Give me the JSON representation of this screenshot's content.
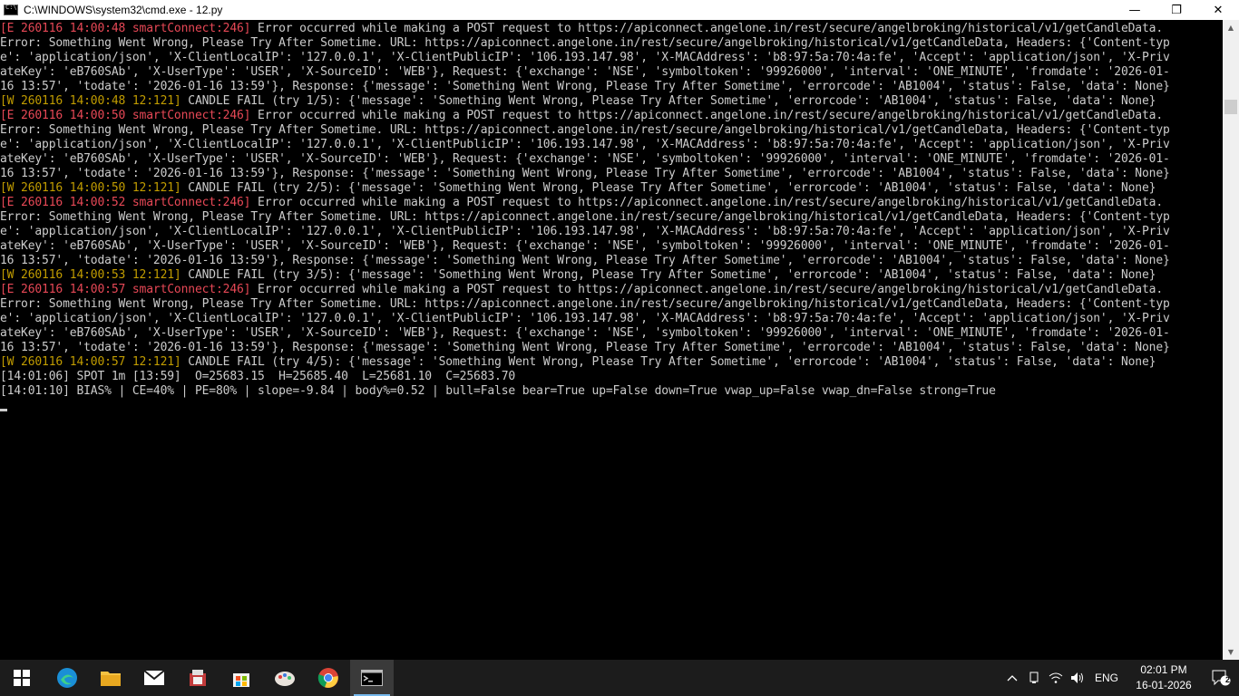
{
  "window": {
    "title": "C:\\WINDOWS\\system32\\cmd.exe - 12.py",
    "minimize_glyph": "—",
    "maximize_glyph": "❐",
    "close_glyph": "✕"
  },
  "console": {
    "lines": [
      {
        "type": "err",
        "prefix": "[E 260116 14:00:48 smartConnect:246]",
        "text": " Error occurred while making a POST request to https://apiconnect.angelone.in/rest/secure/angelbroking/historical/v1/getCandleData."
      },
      {
        "type": "normal",
        "prefix": "",
        "text": "Error: Something Went Wrong, Please Try After Sometime. URL: https://apiconnect.angelone.in/rest/secure/angelbroking/historical/v1/getCandleData, Headers: {'Content-typ"
      },
      {
        "type": "normal",
        "prefix": "",
        "text": "e': 'application/json', 'X-ClientLocalIP': '127.0.0.1', 'X-ClientPublicIP': '106.193.147.98', 'X-MACAddress': 'b8:97:5a:70:4a:fe', 'Accept': 'application/json', 'X-Priv"
      },
      {
        "type": "normal",
        "prefix": "",
        "text": "ateKey': 'eB760SAb', 'X-UserType': 'USER', 'X-SourceID': 'WEB'}, Request: {'exchange': 'NSE', 'symboltoken': '99926000', 'interval': 'ONE_MINUTE', 'fromdate': '2026-01-"
      },
      {
        "type": "normal",
        "prefix": "",
        "text": "16 13:57', 'todate': '2026-01-16 13:59'}, Response: {'message': 'Something Went Wrong, Please Try After Sometime', 'errorcode': 'AB1004', 'status': False, 'data': None}"
      },
      {
        "type": "warn",
        "prefix": "[W 260116 14:00:48 12:121]",
        "text": " CANDLE FAIL (try 1/5): {'message': 'Something Went Wrong, Please Try After Sometime', 'errorcode': 'AB1004', 'status': False, 'data': None}"
      },
      {
        "type": "err",
        "prefix": "[E 260116 14:00:50 smartConnect:246]",
        "text": " Error occurred while making a POST request to https://apiconnect.angelone.in/rest/secure/angelbroking/historical/v1/getCandleData."
      },
      {
        "type": "normal",
        "prefix": "",
        "text": "Error: Something Went Wrong, Please Try After Sometime. URL: https://apiconnect.angelone.in/rest/secure/angelbroking/historical/v1/getCandleData, Headers: {'Content-typ"
      },
      {
        "type": "normal",
        "prefix": "",
        "text": "e': 'application/json', 'X-ClientLocalIP': '127.0.0.1', 'X-ClientPublicIP': '106.193.147.98', 'X-MACAddress': 'b8:97:5a:70:4a:fe', 'Accept': 'application/json', 'X-Priv"
      },
      {
        "type": "normal",
        "prefix": "",
        "text": "ateKey': 'eB760SAb', 'X-UserType': 'USER', 'X-SourceID': 'WEB'}, Request: {'exchange': 'NSE', 'symboltoken': '99926000', 'interval': 'ONE_MINUTE', 'fromdate': '2026-01-"
      },
      {
        "type": "normal",
        "prefix": "",
        "text": "16 13:57', 'todate': '2026-01-16 13:59'}, Response: {'message': 'Something Went Wrong, Please Try After Sometime', 'errorcode': 'AB1004', 'status': False, 'data': None}"
      },
      {
        "type": "warn",
        "prefix": "[W 260116 14:00:50 12:121]",
        "text": " CANDLE FAIL (try 2/5): {'message': 'Something Went Wrong, Please Try After Sometime', 'errorcode': 'AB1004', 'status': False, 'data': None}"
      },
      {
        "type": "err",
        "prefix": "[E 260116 14:00:52 smartConnect:246]",
        "text": " Error occurred while making a POST request to https://apiconnect.angelone.in/rest/secure/angelbroking/historical/v1/getCandleData."
      },
      {
        "type": "normal",
        "prefix": "",
        "text": "Error: Something Went Wrong, Please Try After Sometime. URL: https://apiconnect.angelone.in/rest/secure/angelbroking/historical/v1/getCandleData, Headers: {'Content-typ"
      },
      {
        "type": "normal",
        "prefix": "",
        "text": "e': 'application/json', 'X-ClientLocalIP': '127.0.0.1', 'X-ClientPublicIP': '106.193.147.98', 'X-MACAddress': 'b8:97:5a:70:4a:fe', 'Accept': 'application/json', 'X-Priv"
      },
      {
        "type": "normal",
        "prefix": "",
        "text": "ateKey': 'eB760SAb', 'X-UserType': 'USER', 'X-SourceID': 'WEB'}, Request: {'exchange': 'NSE', 'symboltoken': '99926000', 'interval': 'ONE_MINUTE', 'fromdate': '2026-01-"
      },
      {
        "type": "normal",
        "prefix": "",
        "text": "16 13:57', 'todate': '2026-01-16 13:59'}, Response: {'message': 'Something Went Wrong, Please Try After Sometime', 'errorcode': 'AB1004', 'status': False, 'data': None}"
      },
      {
        "type": "warn",
        "prefix": "[W 260116 14:00:53 12:121]",
        "text": " CANDLE FAIL (try 3/5): {'message': 'Something Went Wrong, Please Try After Sometime', 'errorcode': 'AB1004', 'status': False, 'data': None}"
      },
      {
        "type": "err",
        "prefix": "[E 260116 14:00:57 smartConnect:246]",
        "text": " Error occurred while making a POST request to https://apiconnect.angelone.in/rest/secure/angelbroking/historical/v1/getCandleData."
      },
      {
        "type": "normal",
        "prefix": "",
        "text": "Error: Something Went Wrong, Please Try After Sometime. URL: https://apiconnect.angelone.in/rest/secure/angelbroking/historical/v1/getCandleData, Headers: {'Content-typ"
      },
      {
        "type": "normal",
        "prefix": "",
        "text": "e': 'application/json', 'X-ClientLocalIP': '127.0.0.1', 'X-ClientPublicIP': '106.193.147.98', 'X-MACAddress': 'b8:97:5a:70:4a:fe', 'Accept': 'application/json', 'X-Priv"
      },
      {
        "type": "normal",
        "prefix": "",
        "text": "ateKey': 'eB760SAb', 'X-UserType': 'USER', 'X-SourceID': 'WEB'}, Request: {'exchange': 'NSE', 'symboltoken': '99926000', 'interval': 'ONE_MINUTE', 'fromdate': '2026-01-"
      },
      {
        "type": "normal",
        "prefix": "",
        "text": "16 13:57', 'todate': '2026-01-16 13:59'}, Response: {'message': 'Something Went Wrong, Please Try After Sometime', 'errorcode': 'AB1004', 'status': False, 'data': None}"
      },
      {
        "type": "warn",
        "prefix": "[W 260116 14:00:57 12:121]",
        "text": " CANDLE FAIL (try 4/5): {'message': 'Something Went Wrong, Please Try After Sometime', 'errorcode': 'AB1004', 'status': False, 'data': None}"
      },
      {
        "type": "normal",
        "prefix": "",
        "text": "[14:01:06] SPOT 1m [13:59]  O=25683.15  H=25685.40  L=25681.10  C=25683.70"
      },
      {
        "type": "normal",
        "prefix": "",
        "text": "[14:01:10] BIAS% | CE=40% | PE=80% | slope=-9.84 | body%=0.52 | bull=False bear=True up=False down=True vwap_up=False vwap_dn=False strong=True"
      }
    ]
  },
  "colors": {
    "console_bg": "#000000",
    "console_fg": "#cccccc",
    "error_red": "#e74856",
    "warn_yellow": "#c19c00",
    "taskbar_bg": "#1c1c1c"
  },
  "taskbar": {
    "apps": [
      {
        "name": "start-button",
        "icon": "windows-logo-icon"
      },
      {
        "name": "edge-app",
        "icon": "edge-icon"
      },
      {
        "name": "file-explorer-app",
        "icon": "folder-icon"
      },
      {
        "name": "mail-app",
        "icon": "mail-icon"
      },
      {
        "name": "app-generic",
        "icon": "app-icon"
      },
      {
        "name": "store-app",
        "icon": "store-icon"
      },
      {
        "name": "paint-app",
        "icon": "paint-icon"
      },
      {
        "name": "chrome-app",
        "icon": "chrome-icon"
      },
      {
        "name": "cmd-app",
        "icon": "cmd-icon"
      }
    ],
    "tray": {
      "language": "ENG",
      "time": "02:01 PM",
      "date": "16-01-2026",
      "notification_count": "2"
    }
  }
}
